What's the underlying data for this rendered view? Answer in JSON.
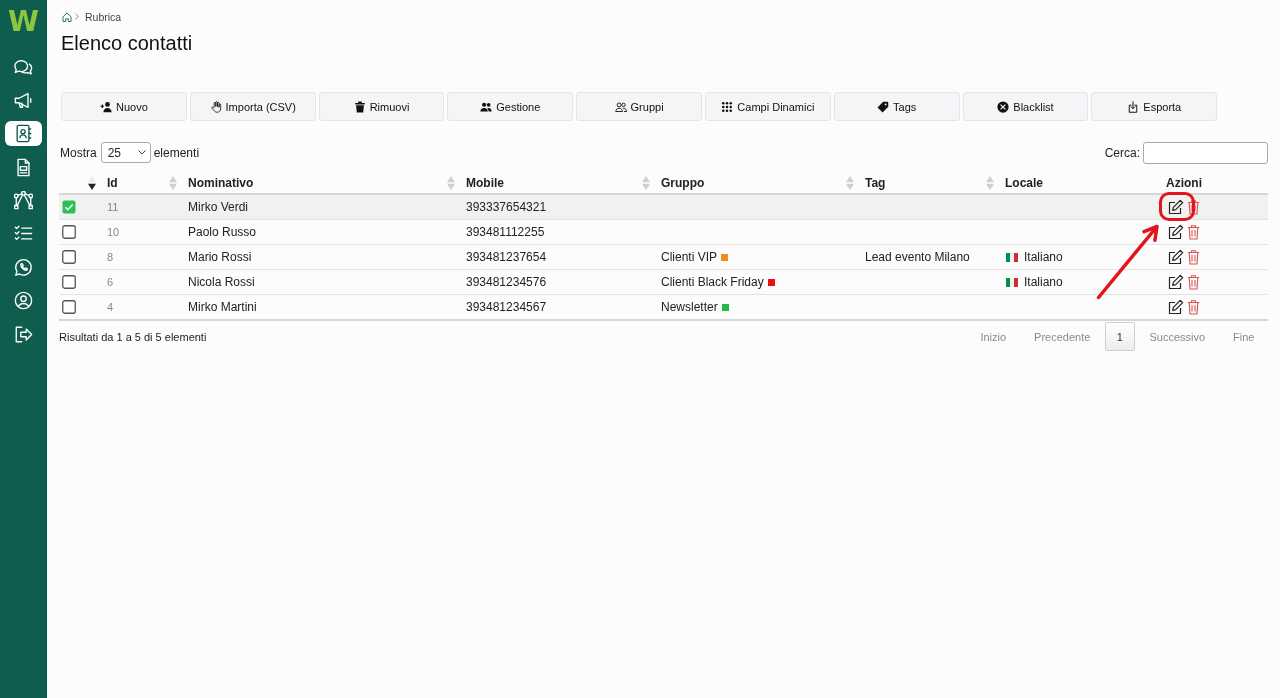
{
  "sidebar": {
    "logo": "W",
    "items": [
      {
        "kind": "chat",
        "selected": false
      },
      {
        "kind": "megaphone",
        "selected": false
      },
      {
        "kind": "contacts",
        "selected": true
      },
      {
        "kind": "document",
        "selected": false
      },
      {
        "kind": "flow",
        "selected": false
      },
      {
        "kind": "checklist",
        "selected": false
      },
      {
        "kind": "whatsapp",
        "selected": false
      },
      {
        "kind": "profile",
        "selected": false
      },
      {
        "kind": "logout",
        "selected": false
      }
    ]
  },
  "breadcrumb": [
    "Rubrica"
  ],
  "title": "Elenco contatti",
  "toolbar": [
    {
      "kind": "user-plus",
      "label": "Nuovo"
    },
    {
      "kind": "hand",
      "label": "Importa (CSV)"
    },
    {
      "kind": "trash",
      "label": "Rimuovi"
    },
    {
      "kind": "users",
      "label": "Gestione"
    },
    {
      "kind": "users-outline",
      "label": "Gruppi"
    },
    {
      "kind": "grid",
      "label": "Campi Dinamici"
    },
    {
      "kind": "tag",
      "label": "Tags"
    },
    {
      "kind": "x-circle",
      "label": "Blacklist"
    },
    {
      "kind": "export",
      "label": "Esporta"
    }
  ],
  "controls": {
    "show_label": "Mostra",
    "page_size": "25",
    "entries_label": "elementi",
    "search_label": "Cerca:"
  },
  "table": {
    "columns": [
      {
        "sortable": true,
        "sorted": true
      },
      {
        "label": "Id",
        "sortable": true,
        "sorted": false
      },
      {
        "label": "Nominativo",
        "sortable": true,
        "sorted": false
      },
      {
        "label": "Mobile",
        "sortable": true,
        "sorted": false
      },
      {
        "label": "Gruppo",
        "sortable": true,
        "sorted": false
      },
      {
        "label": "Tag",
        "sortable": true,
        "sorted": false
      },
      {
        "label": "Locale",
        "sortable": false
      },
      {
        "label": "Azioni",
        "sortable": false
      }
    ],
    "rows": [
      {
        "selected": true,
        "id": "11",
        "name": "Mirko Verdi",
        "mobile": "393337654321",
        "highlighted": true
      },
      {
        "selected": false,
        "id": "10",
        "name": "Paolo Russo",
        "mobile": "393481112255",
        "highlighted": false
      },
      {
        "selected": false,
        "id": "8",
        "name": "Mario Rossi",
        "mobile": "393481237654",
        "group": {
          "name": "Clienti VIP",
          "color": "#f28a1c"
        },
        "tag": "Lead evento Milano",
        "locale": "Italiano",
        "highlighted": false
      },
      {
        "selected": false,
        "id": "6",
        "name": "Nicola Rossi",
        "mobile": "393481234576",
        "group": {
          "name": "Clienti Black Friday",
          "color": "#e8100c"
        },
        "locale": "Italiano",
        "highlighted": false
      },
      {
        "selected": false,
        "id": "4",
        "name": "Mirko Martini",
        "mobile": "393481234567",
        "group": {
          "name": "Newsletter",
          "color": "#22b94a"
        },
        "highlighted": false
      }
    ]
  },
  "info": "Risultati da 1 a 5 di 5 elementi",
  "pagination": [
    {
      "label": "Inizio",
      "disabled": true,
      "selected": false
    },
    {
      "label": "Precedente",
      "disabled": true,
      "selected": false
    },
    {
      "label": "1",
      "disabled": false,
      "selected": true
    },
    {
      "label": "Successivo",
      "disabled": true,
      "selected": false
    },
    {
      "label": "Fine",
      "disabled": true,
      "selected": false
    }
  ]
}
